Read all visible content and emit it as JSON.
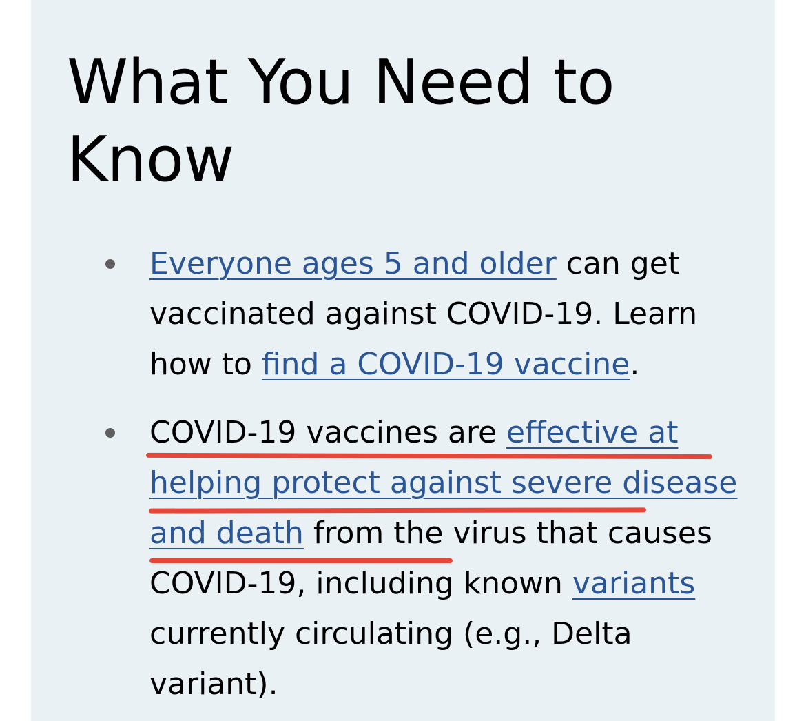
{
  "colors": {
    "card_background": "#e9f1f5",
    "link": "#2a5597",
    "bullet": "#5f5f5f",
    "highlight_underline": "#e5473a"
  },
  "heading": "What You Need to Know",
  "bullets": [
    {
      "link1": "Everyone ages 5 and older",
      "text1": " can get vaccinated against COVID-19. Learn how to ",
      "link2": "find a COVID-19 vaccine",
      "text2": "."
    },
    {
      "text1": "COVID-19 vaccines are ",
      "link1": "effective at helping protect against severe disease and death",
      "text2": " from the virus that causes COVID-19, including known ",
      "link2": "variants",
      "text3": " currently circulating (e.g., Delta variant)."
    }
  ]
}
